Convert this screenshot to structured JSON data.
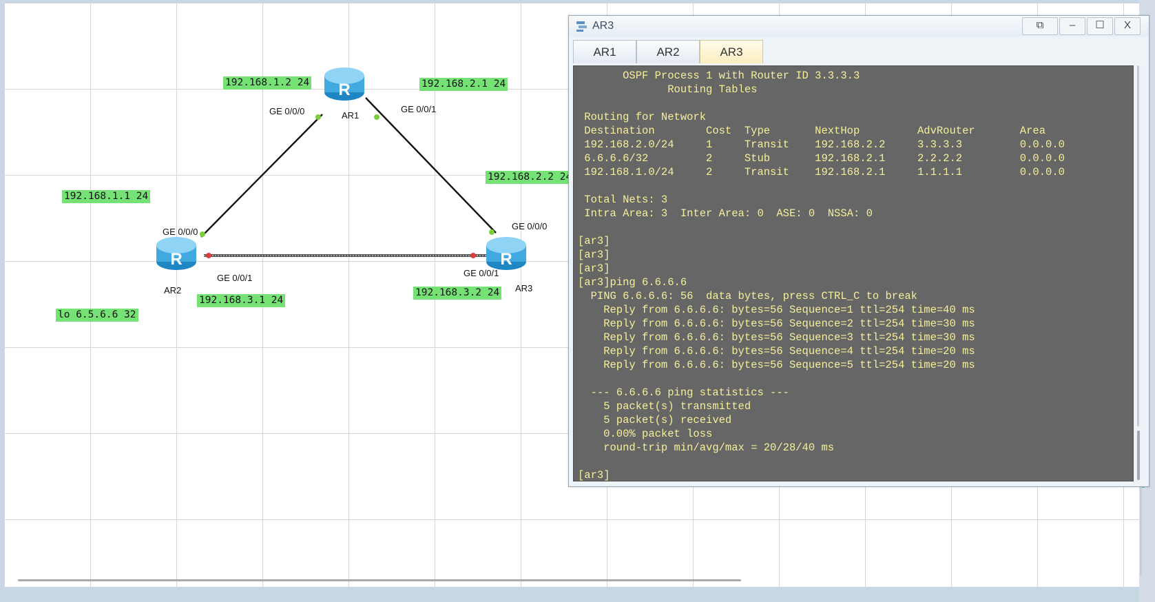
{
  "window": {
    "title": "AR3",
    "buttons": {
      "restore": "⧉",
      "minimize": "–",
      "maximize": "☐",
      "close": "X"
    },
    "tabs": [
      {
        "label": "AR1",
        "active": false
      },
      {
        "label": "AR2",
        "active": false
      },
      {
        "label": "AR3",
        "active": true
      }
    ]
  },
  "terminal": {
    "lines": [
      "       OSPF Process 1 with Router ID 3.3.3.3",
      "              Routing Tables",
      "",
      " Routing for Network",
      " Destination        Cost  Type       NextHop         AdvRouter       Area",
      " 192.168.2.0/24     1     Transit    192.168.2.2     3.3.3.3         0.0.0.0",
      " 6.6.6.6/32         2     Stub       192.168.2.1     2.2.2.2         0.0.0.0",
      " 192.168.1.0/24     2     Transit    192.168.2.1     1.1.1.1         0.0.0.0",
      "",
      " Total Nets: 3",
      " Intra Area: 3  Inter Area: 0  ASE: 0  NSSA: 0",
      "",
      "[ar3]",
      "[ar3]",
      "[ar3]",
      "[ar3]ping 6.6.6.6",
      "  PING 6.6.6.6: 56  data bytes, press CTRL_C to break",
      "    Reply from 6.6.6.6: bytes=56 Sequence=1 ttl=254 time=40 ms",
      "    Reply from 6.6.6.6: bytes=56 Sequence=2 ttl=254 time=30 ms",
      "    Reply from 6.6.6.6: bytes=56 Sequence=3 ttl=254 time=30 ms",
      "    Reply from 6.6.6.6: bytes=56 Sequence=4 ttl=254 time=20 ms",
      "    Reply from 6.6.6.6: bytes=56 Sequence=5 ttl=254 time=20 ms",
      "",
      "  --- 6.6.6.6 ping statistics ---",
      "    5 packet(s) transmitted",
      "    5 packet(s) received",
      "    0.00% packet loss",
      "    round-trip min/avg/max = 20/28/40 ms",
      "",
      "[ar3]"
    ]
  },
  "topology": {
    "devices": {
      "ar1": "AR1",
      "ar2": "AR2",
      "ar3": "AR3",
      "router_glyph": "R"
    },
    "ports": {
      "ar1_ge000": "GE 0/0/0",
      "ar1_ge001": "GE 0/0/1",
      "ar2_ge000": "GE 0/0/0",
      "ar2_ge001": "GE 0/0/1",
      "ar3_ge000": "GE 0/0/0",
      "ar3_ge001": "GE 0/0/1"
    },
    "ip_labels": {
      "ar1_left": "192.168.1.2 24",
      "ar1_right": "192.168.2.1 24",
      "ar3_top": "192.168.2.2 24",
      "ar2_top": "192.168.1.1 24",
      "ar2_bottom": "192.168.3.1 24",
      "ar3_bottom": "192.168.3.2 24",
      "loopback": "lo 6.5.6.6 32"
    },
    "colors": {
      "label_bg": "#76e276",
      "port_up": "#7ccf3a",
      "port_down": "#e03c3c",
      "router": "#3fa9e0"
    }
  },
  "icons": [
    "app-icon",
    "router-icon"
  ]
}
